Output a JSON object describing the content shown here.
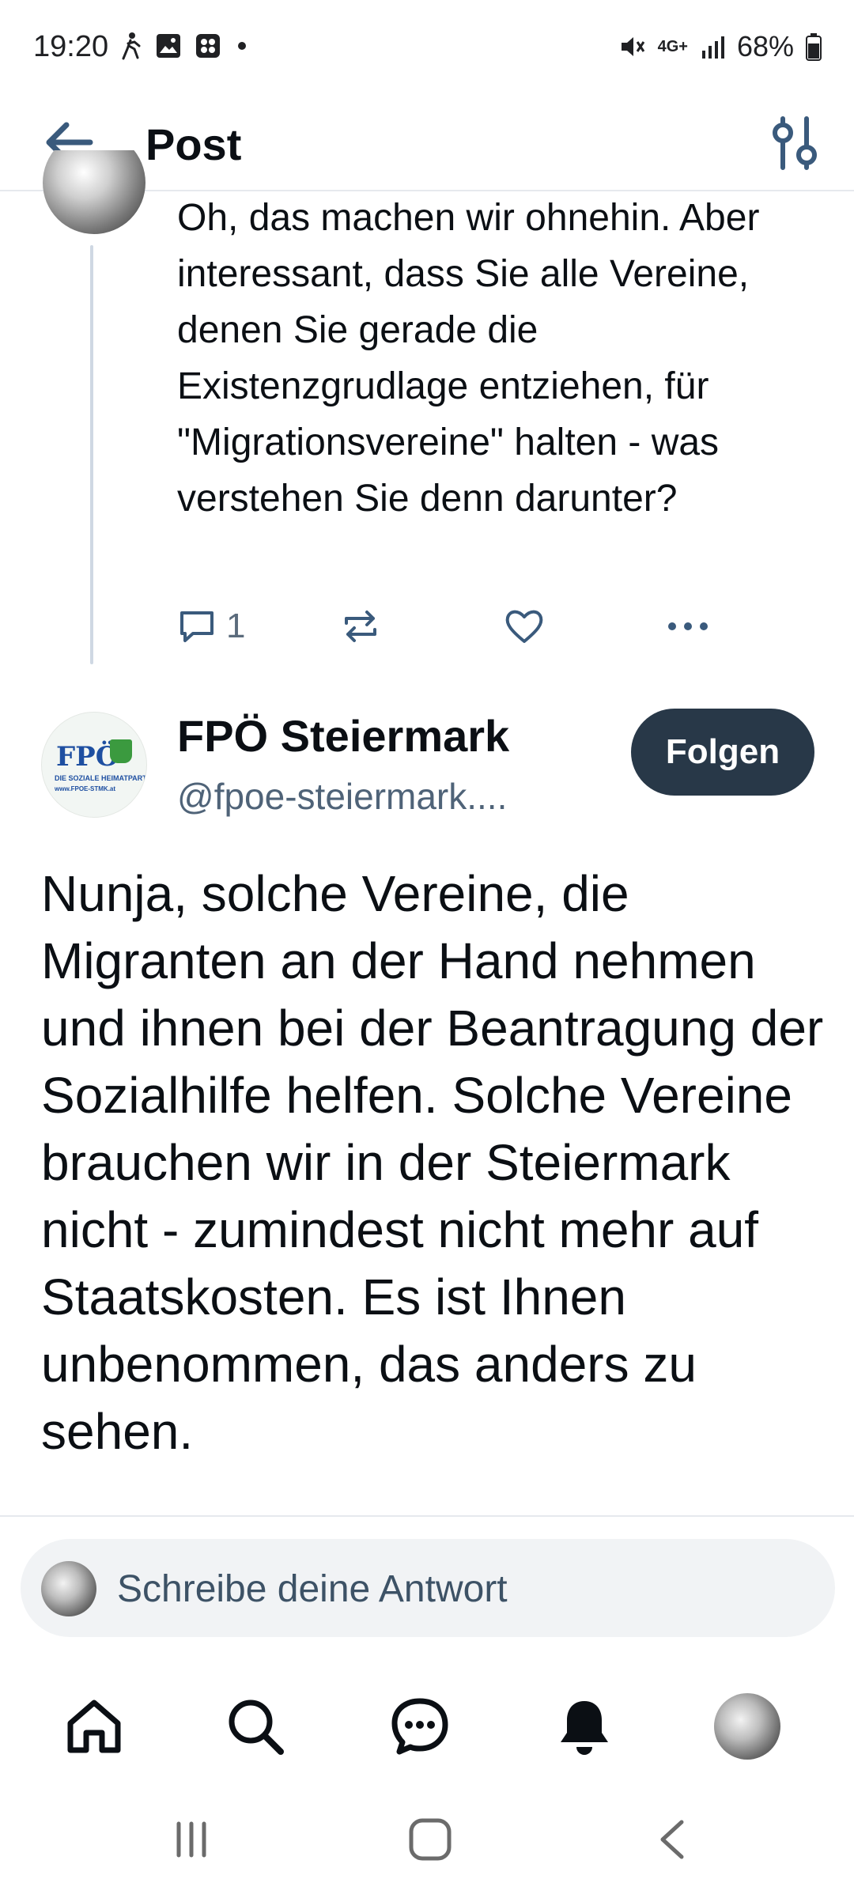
{
  "status_bar": {
    "time": "19:20",
    "battery": "68%",
    "network": "4G+",
    "icons": [
      "walk-icon",
      "image-icon",
      "app-icon",
      "dot-icon",
      "mute-icon",
      "network-icon",
      "signal-icon",
      "battery-icon"
    ]
  },
  "header": {
    "title": "Post",
    "back_icon": "arrow-left-icon",
    "filter_icon": "sliders-icon"
  },
  "parent_post": {
    "text": "Oh, das machen wir ohnehin. Aber interessant, dass Sie alle Vereine, denen Sie gerade die Existenzgrudlage entziehen, für \"Migrationsvereine\" halten - was verstehen Sie denn darunter?",
    "reply_count": "1"
  },
  "post": {
    "author_name": "FPÖ Steiermark",
    "author_handle": "@fpoe-steiermark....",
    "follow_label": "Folgen",
    "avatar": {
      "logo_text": "FPÖ",
      "logo_sub": "DIE SOZIALE HEIMATPARTEI",
      "logo_url": "www.FPOE-STMK.at"
    },
    "text": "Nunja, solche Vereine, die Migranten an der Hand nehmen und ihnen bei der Beantragung der Sozialhilfe helfen. Solche Vereine brauchen wir in der Steiermark nicht - zumindest nicht mehr auf Staatskosten. Es ist Ihnen unbenommen, das anders zu sehen."
  },
  "reply": {
    "placeholder": "Schreibe deine Antwort"
  },
  "bottom_nav": [
    "home-icon",
    "search-icon",
    "chat-icon",
    "bell-icon",
    "profile-avatar"
  ],
  "colors": {
    "accent": "#283848",
    "muted": "#5b6b7c",
    "thread_line": "#cfd8e3",
    "reply_bg": "#f1f3f5"
  }
}
